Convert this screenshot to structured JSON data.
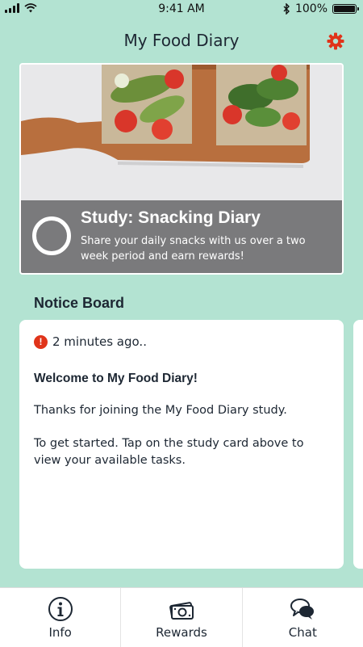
{
  "status_bar": {
    "time": "9:41 AM",
    "battery_percent": "100%",
    "icons": [
      "signal-icon",
      "wifi-icon",
      "bluetooth-icon",
      "battery-icon"
    ]
  },
  "header": {
    "title": "My Food Diary",
    "settings_icon": "gear-icon",
    "accent_color": "#e0341a"
  },
  "study_card": {
    "title": "Study: Snacking Diary",
    "description": "Share your daily snacks with us over a two week period and earn rewards!"
  },
  "notice_board": {
    "heading": "Notice Board",
    "notice": {
      "time": "2 minutes ago..",
      "title": "Welcome to My Food Diary!",
      "paragraphs": [
        "Thanks for joining the My Food Diary study.",
        "To get started. Tap on the study card above to view your available tasks."
      ]
    }
  },
  "tab_bar": {
    "tabs": [
      {
        "label": "Info",
        "icon": "info-icon"
      },
      {
        "label": "Rewards",
        "icon": "money-icon"
      },
      {
        "label": "Chat",
        "icon": "chat-icon"
      }
    ]
  },
  "colors": {
    "background": "#b3e3d2",
    "overlay": "#6e6e70",
    "alert": "#e0341a"
  }
}
